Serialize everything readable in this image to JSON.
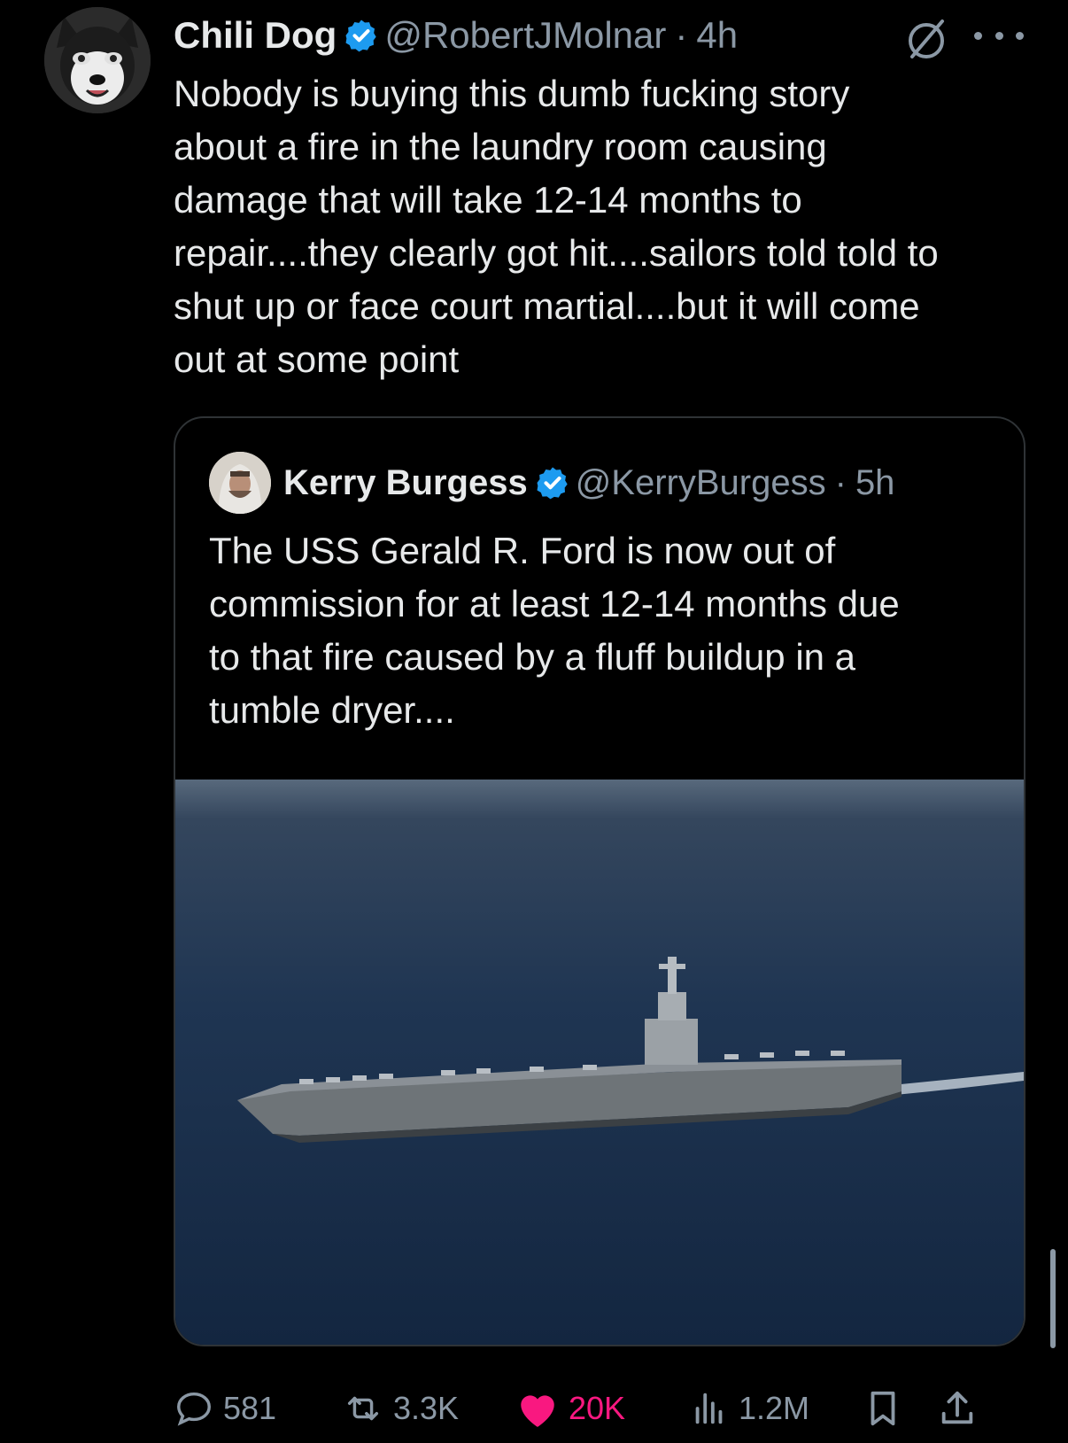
{
  "tweet": {
    "author_name": "Chili Dog",
    "handle": "@RobertJMolnar",
    "separator": "·",
    "time": "4h",
    "text": "Nobody is buying this dumb fucking story\nabout a fire in the laundry room causing\ndamage that will take 12-14 months to\nrepair....they clearly got hit....sailors told told to\nshut up or face court martial....but it will come\nout at some point"
  },
  "quoted_tweet": {
    "author_name": "Kerry Burgess",
    "handle": "@KerryBurgess",
    "separator": "·",
    "time": "5h",
    "text": "The USS Gerald R. Ford is now out of\ncommission for at least 12-14 months due\nto that fire caused by a fluff buildup in a\ntumble dryer...."
  },
  "actions": {
    "replies": "581",
    "reposts": "3.3K",
    "likes": "20K",
    "views": "1.2M"
  },
  "colors": {
    "background": "#000000",
    "text": "#e7e9ea",
    "secondary": "#8b98a5",
    "verified": "#1d9bf0",
    "like": "#f91880"
  }
}
